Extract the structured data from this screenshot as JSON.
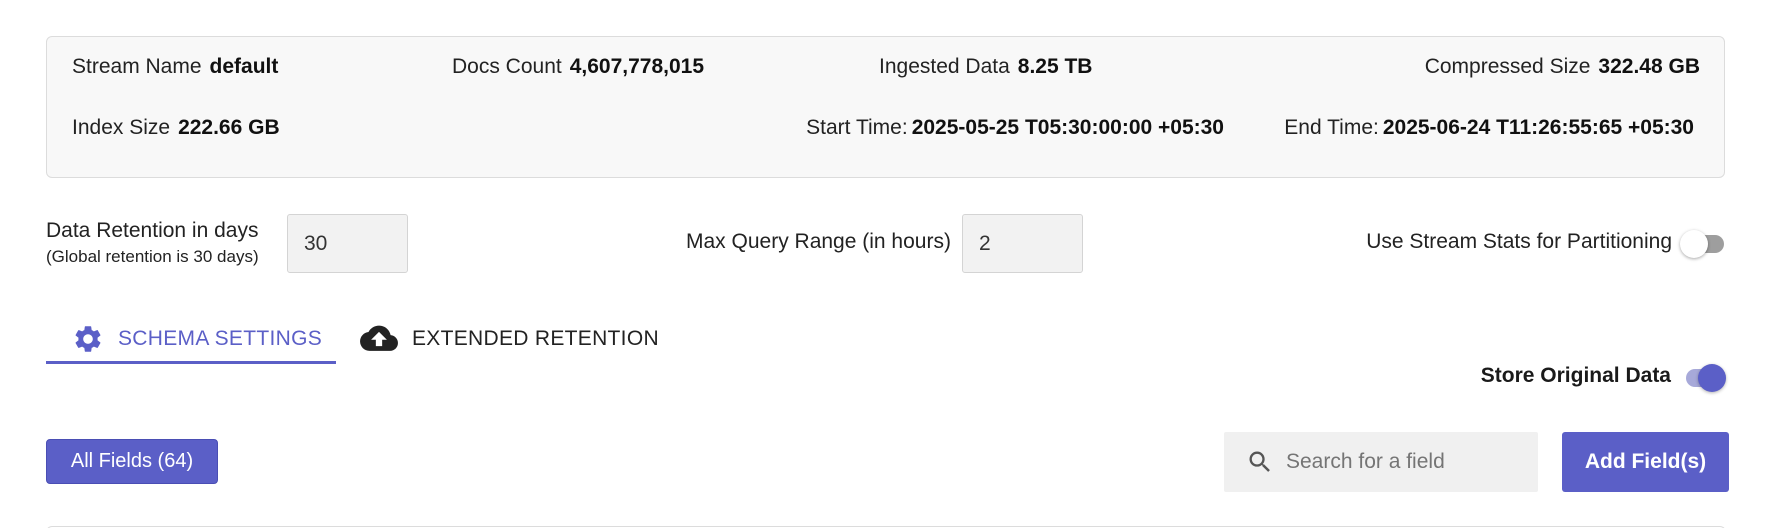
{
  "stats": {
    "stream_name": {
      "label": "Stream Name",
      "value": "default"
    },
    "docs_count": {
      "label": "Docs Count",
      "value": "4,607,778,015"
    },
    "ingested_data": {
      "label": "Ingested Data",
      "value": "8.25 TB"
    },
    "compressed_size": {
      "label": "Compressed Size",
      "value": "322.48 GB"
    },
    "index_size": {
      "label": "Index Size",
      "value": "222.66 GB"
    },
    "start_time": {
      "label": "Start Time:",
      "value": "2025-05-25 T05:30:00:00 +05:30"
    },
    "end_time": {
      "label": "End Time:",
      "value": "2025-06-24 T11:26:55:65 +05:30"
    }
  },
  "settings": {
    "retention_label": "Data Retention in days",
    "retention_sublabel": "(Global retention is 30 days)",
    "retention_value": "30",
    "max_query_label": "Max Query Range (in hours)",
    "max_query_value": "2",
    "stream_stats_label": "Use Stream Stats for Partitioning",
    "stream_stats_enabled": false
  },
  "tabs": [
    {
      "label": "SCHEMA SETTINGS",
      "icon": "gear-icon",
      "active": true
    },
    {
      "label": "EXTENDED RETENTION",
      "icon": "cloud-upload-icon",
      "active": false
    }
  ],
  "store_original": {
    "label": "Store Original Data",
    "enabled": true
  },
  "fields": {
    "all_fields_label": "All Fields (64)",
    "search_placeholder": "Search for a field",
    "add_button_label": "Add Field(s)"
  },
  "colors": {
    "accent": "#5b5fc7",
    "card_bg": "#f8f8f8",
    "input_bg": "#f2f2f2"
  }
}
